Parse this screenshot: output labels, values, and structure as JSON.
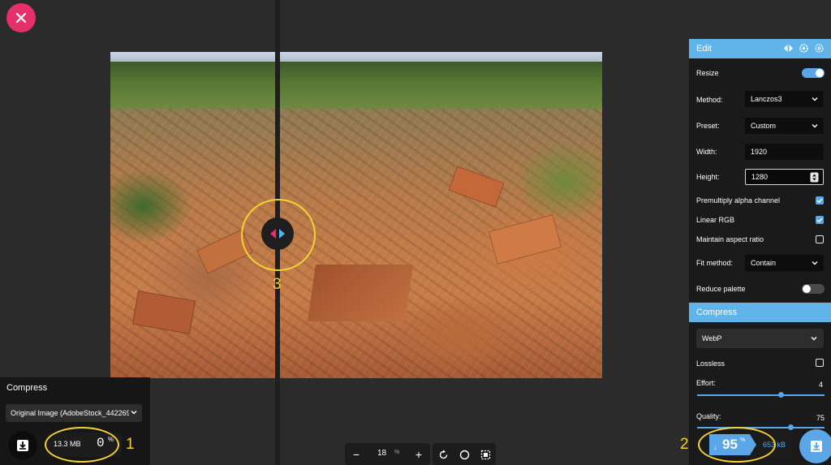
{
  "close_label": "✕",
  "annotations": {
    "left": "1",
    "right": "2",
    "handle": "3"
  },
  "left_panel": {
    "title": "Compress",
    "source_select": "Original Image (AdobeStock_442269",
    "file_size": "13.3 MB",
    "percent": "0",
    "percent_sign": "%"
  },
  "zoom": {
    "minus": "−",
    "value": "18",
    "unit": "%",
    "plus": "+"
  },
  "edit_panel": {
    "title": "Edit",
    "resize_label": "Resize",
    "resize_on": true,
    "method_label": "Method:",
    "method_value": "Lanczos3",
    "preset_label": "Preset:",
    "preset_value": "Custom",
    "width_label": "Width:",
    "width_value": "1920",
    "height_label": "Height:",
    "height_value": "1280",
    "premultiply_label": "Premultiply alpha channel",
    "premultiply_checked": true,
    "linear_rgb_label": "Linear RGB",
    "linear_rgb_checked": true,
    "aspect_label": "Maintain aspect ratio",
    "aspect_checked": false,
    "fit_label": "Fit method:",
    "fit_value": "Contain",
    "reduce_palette_label": "Reduce palette",
    "reduce_palette_on": false
  },
  "compress_panel": {
    "title": "Compress",
    "format_value": "WebP",
    "lossless_label": "Lossless",
    "lossless_checked": false,
    "effort_label": "Effort:",
    "effort_value": "4",
    "effort_level": 0.67,
    "quality_label": "Quality:",
    "quality_value": "75",
    "quality_level": 0.75
  },
  "result": {
    "arrow": "↓",
    "percent": "95",
    "percent_sign": "%",
    "file_size": "653 kB"
  },
  "colors": {
    "accent": "#5aa6e6",
    "close": "#e5306a",
    "annotation": "#f2d235"
  }
}
